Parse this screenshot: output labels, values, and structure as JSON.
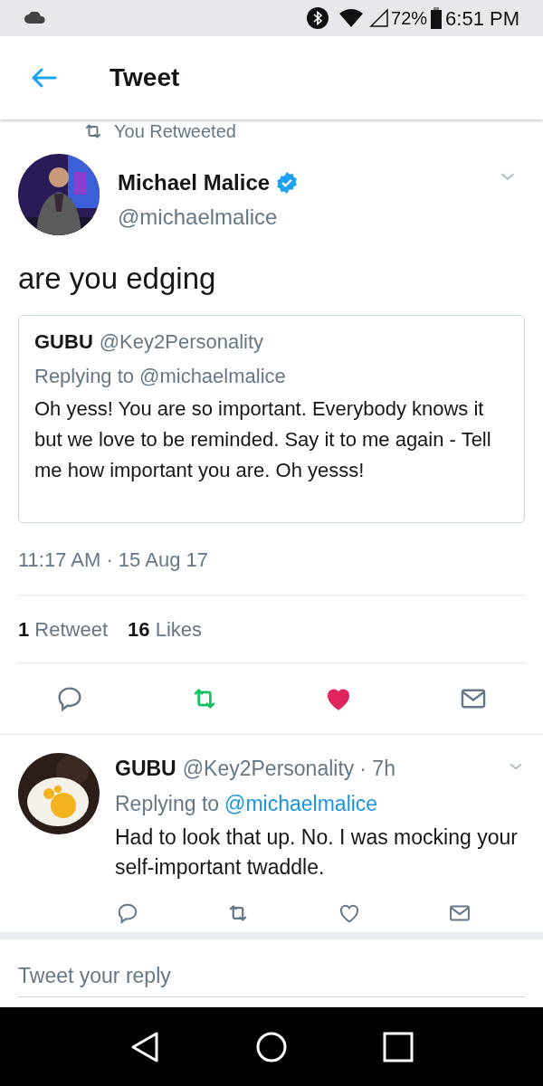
{
  "status_bar": {
    "battery": "72%",
    "time": "6:51 PM"
  },
  "header": {
    "title": "Tweet"
  },
  "retweet_context": "You Retweeted",
  "tweet": {
    "name": "Michael Malice",
    "verified": true,
    "handle": "@michaelmalice",
    "text": "are you edging",
    "quote": {
      "name": "GUBU",
      "handle": "@Key2Personality",
      "replying_label": "Replying to",
      "replying_handle": "@michaelmalice",
      "text": "Oh yess! You are so important. Everybody knows it but we love to be reminded. Say it to me again - Tell me how important you are. Oh yesss!"
    },
    "timestamp": "11:17 AM · 15 Aug 17",
    "stats": [
      {
        "count": "1",
        "label": "Retweet"
      },
      {
        "count": "16",
        "label": "Likes"
      }
    ],
    "retweeted": true,
    "liked": true
  },
  "replies": [
    {
      "name": "GUBU",
      "handle": "@Key2Personality",
      "time": "· 7h",
      "replying_label": "Replying to",
      "replying_handle": "@michaelmalice",
      "text": "Had to look that up. No. I was mocking your self-important twaddle.",
      "retweeted": false,
      "liked": false
    }
  ],
  "reply_box": {
    "placeholder": "Tweet your reply"
  }
}
